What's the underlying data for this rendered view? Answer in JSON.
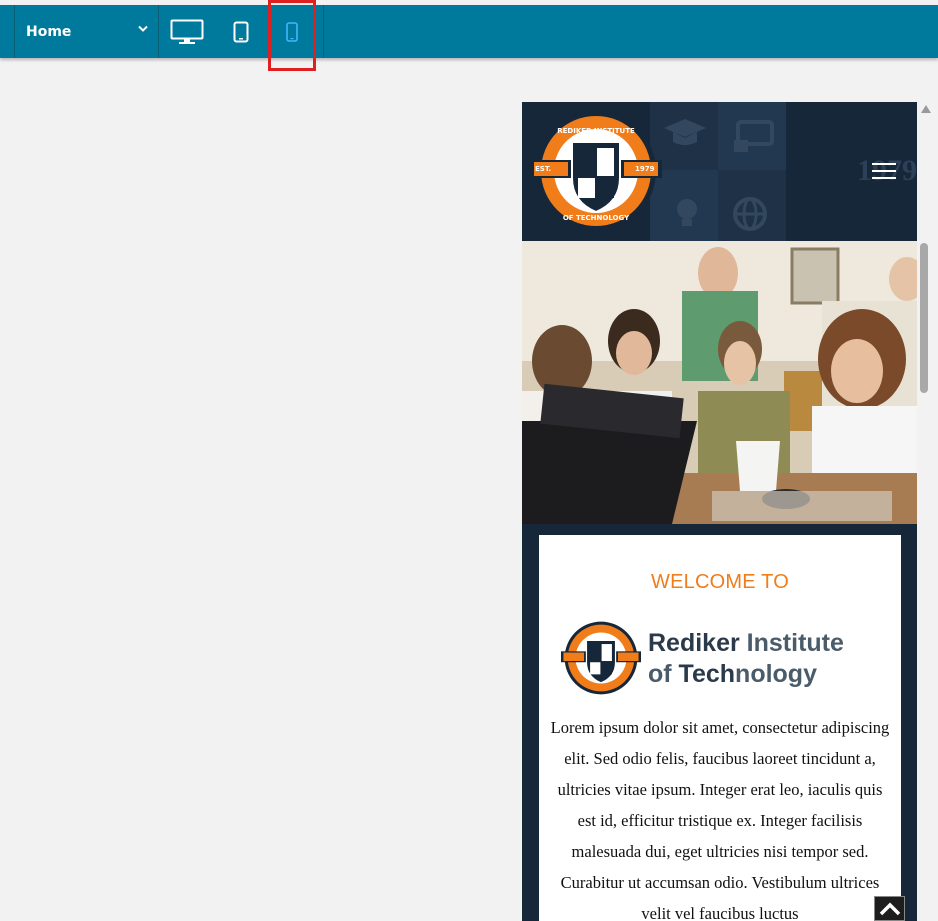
{
  "toolbar": {
    "page_select": {
      "value": "Home",
      "icon": "chevron-down-icon"
    },
    "devices": [
      {
        "name": "desktop",
        "icon": "monitor-icon",
        "active": false
      },
      {
        "name": "tablet",
        "icon": "tablet-icon",
        "active": false
      },
      {
        "name": "mobile",
        "icon": "smartphone-icon",
        "active": true
      }
    ],
    "colors": {
      "bar": "#007a9c",
      "active_device": "#3db8ff",
      "highlight": "#e02020"
    }
  },
  "preview": {
    "header": {
      "logo_top_text": "REDIKER INSTITUTE",
      "logo_bottom_text": "OF TECHNOLOGY",
      "logo_est": "EST.",
      "logo_year": "1979",
      "bg_year": "1979",
      "menu_icon": "hamburger-icon"
    },
    "hero": {
      "description_icon": "students-photo"
    },
    "welcome": {
      "title": "WELCOME TO",
      "brand_line1_a": "Rediker",
      "brand_line1_b": "Institute",
      "brand_line2_a": "of ",
      "brand_line2_b": "Tech",
      "brand_line2_c": "nology",
      "body": "Lorem ipsum dolor sit amet, consectetur adipiscing elit. Sed odio felis, faucibus laoreet tincidunt a, ultricies vitae ipsum. Integer erat leo, iaculis quis est id, efficitur tristique ex. Integer facilisis malesuada dui, eget ultricies nisi tempor sed. Curabitur ut accumsan odio. Vestibulum ultrices velit vel faucibus luctus"
    },
    "colors": {
      "navy": "#16273a",
      "orange": "#f07d1a"
    },
    "back_to_top_icon": "chevron-up-icon"
  }
}
